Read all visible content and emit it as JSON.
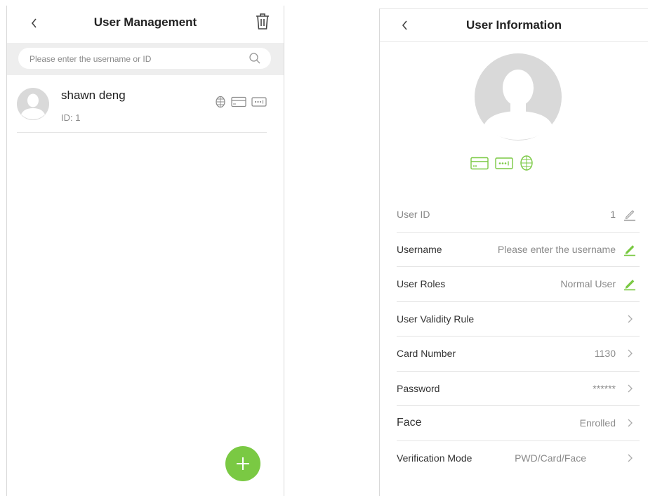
{
  "user_management": {
    "title": "User Management",
    "search": {
      "placeholder": "Please enter the username or ID",
      "value": ""
    },
    "users": [
      {
        "name": "shawn deng",
        "id_text": "ID: 1"
      }
    ]
  },
  "user_information": {
    "title": "User Information",
    "fields": [
      {
        "label": "User ID",
        "value": "1",
        "action": "edit-icon-gray"
      },
      {
        "label": "Username",
        "value": "Please enter the username",
        "action": "edit-icon-green"
      },
      {
        "label": "User Roles",
        "value": "Normal User",
        "action": "edit-icon-green"
      },
      {
        "label": "User Validity Rule",
        "value": "",
        "action": "chevron-right-icon"
      },
      {
        "label": "Card Number",
        "value": "1130",
        "action": "chevron-right-icon"
      },
      {
        "label": "Password",
        "value": "******",
        "action": "chevron-right-icon"
      },
      {
        "label": "Face",
        "value": "Enrolled",
        "action": "chevron-right-icon"
      },
      {
        "label": "Verification Mode",
        "value": "PWD/Card/Face",
        "action": "chevron-right-icon"
      }
    ]
  },
  "colors": {
    "accent": "#7ac943",
    "icon_gray": "#8a8a8a",
    "avatar_bg": "#d9d9d9",
    "search_bg": "#eeeeee"
  }
}
